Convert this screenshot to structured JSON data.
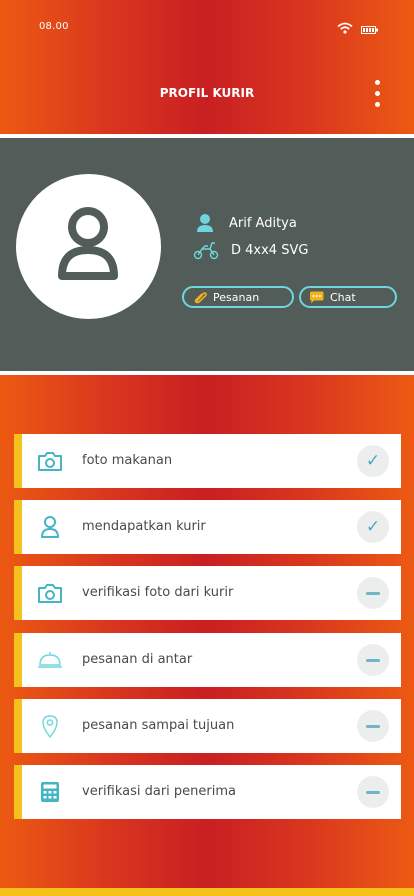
{
  "status_bar": {
    "time": "08.00"
  },
  "header": {
    "title": "PROFIL KURIR"
  },
  "courier": {
    "name": "Arif Aditya",
    "plate": "D 4xx4 SVG"
  },
  "actions": {
    "orders_label": "Pesanan",
    "chat_label": "Chat"
  },
  "steps": [
    {
      "label": "foto makanan",
      "status": "done"
    },
    {
      "label": "mendapatkan kurir",
      "status": "done"
    },
    {
      "label": "verifikasi foto dari kurir",
      "status": "pending"
    },
    {
      "label": "pesanan di antar",
      "status": "pending"
    },
    {
      "label": "pesanan sampai tujuan",
      "status": "pending"
    },
    {
      "label": "verifikasi dari penerima",
      "status": "pending"
    }
  ],
  "colors": {
    "header_red": "#c91f22",
    "header_orange": "#ec5a12",
    "profile_bg": "#525c58",
    "accent_teal": "#6ed6dc",
    "accent_yellow": "#f4c21c",
    "status_blue": "#4fa4c4"
  }
}
